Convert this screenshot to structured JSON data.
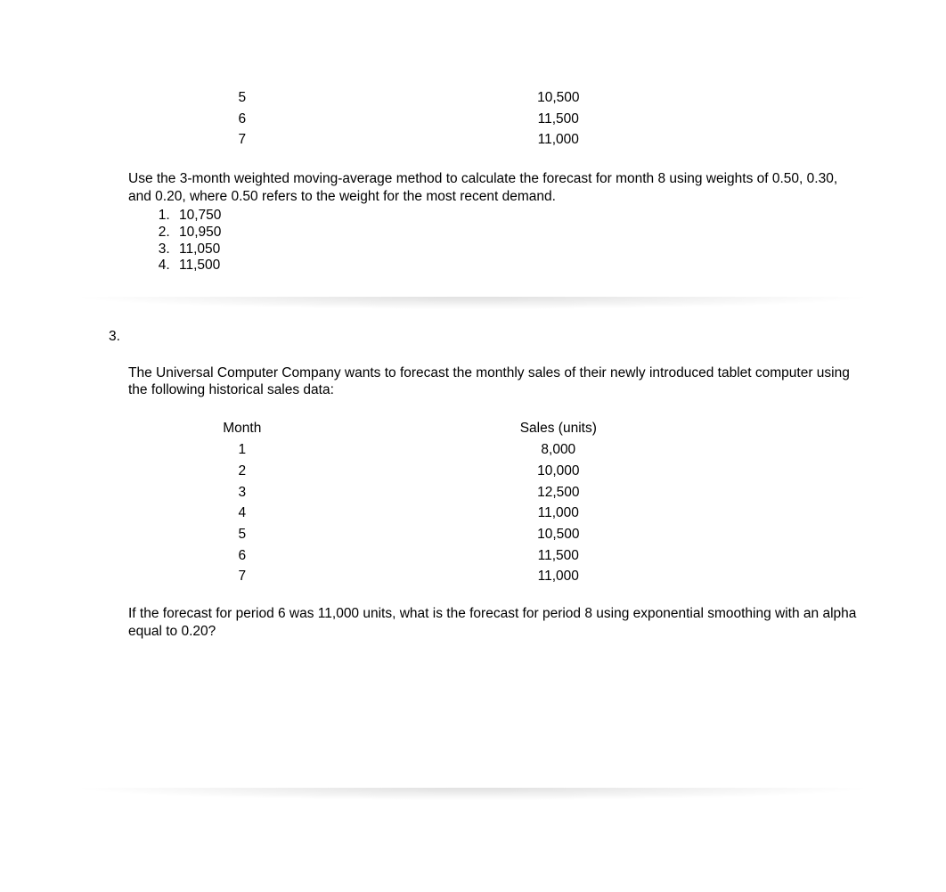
{
  "q2_partial_rows": [
    {
      "month": "5",
      "sales": "10,500"
    },
    {
      "month": "6",
      "sales": "11,500"
    },
    {
      "month": "7",
      "sales": "11,000"
    }
  ],
  "q2_prompt": "Use the 3-month weighted moving-average method to calculate the forecast for month 8 using weights of 0.50, 0.30, and 0.20, where 0.50 refers to the weight for the most recent demand.",
  "q2_answers": [
    "10,750",
    "10,950",
    "11,050",
    "11,500"
  ],
  "q3_number": "3.",
  "q3_intro": "The Universal Computer Company wants to forecast the monthly sales of their newly introduced tablet computer using the following historical sales data:",
  "q3_headers": {
    "month": "Month",
    "sales": "Sales (units)"
  },
  "q3_rows": [
    {
      "month": "1",
      "sales": "8,000"
    },
    {
      "month": "2",
      "sales": "10,000"
    },
    {
      "month": "3",
      "sales": "12,500"
    },
    {
      "month": "4",
      "sales": "11,000"
    },
    {
      "month": "5",
      "sales": "10,500"
    },
    {
      "month": "6",
      "sales": "11,500"
    },
    {
      "month": "7",
      "sales": "11,000"
    }
  ],
  "q3_followup": "If the forecast for period 6 was 11,000 units, what is the forecast for period 8 using exponential smoothing with an alpha equal to 0.20?"
}
